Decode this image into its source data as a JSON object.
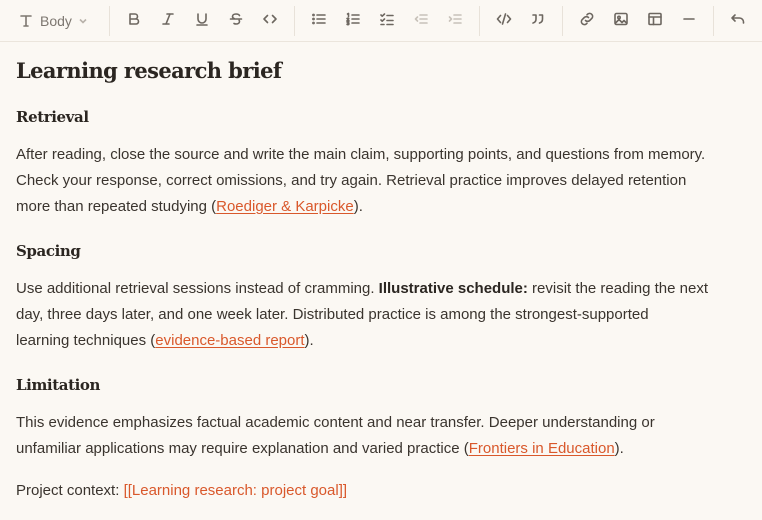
{
  "toolbar": {
    "text_style": "Body",
    "icons": [
      "text-type-icon",
      "bold-icon",
      "italic-icon",
      "underline-icon",
      "strikethrough-icon",
      "inline-code-icon",
      "bullet-list-icon",
      "numbered-list-icon",
      "task-list-icon",
      "outdent-icon",
      "indent-icon",
      "code-block-icon",
      "blockquote-icon",
      "link-icon",
      "image-icon",
      "table-icon",
      "horizontal-rule-icon",
      "undo-icon"
    ]
  },
  "doc": {
    "title": "Learning research brief",
    "sections": [
      {
        "heading": "Retrieval",
        "line1": "After reading, close the source and write the main claim, supporting points, and questions from memory.",
        "line2": "Check your response, correct omissions, and try again. Retrieval practice improves delayed retention",
        "line3_pre": "more than repeated studying (",
        "link": "Roediger & Karpicke",
        "line3_post": ")."
      },
      {
        "heading": "Spacing",
        "line1_pre": "Use additional retrieval sessions instead of cramming. ",
        "bold": "Illustrative schedule:",
        "line1_post": " revisit the reading the next",
        "line2": "day, three days later, and one week later. Distributed practice is among the strongest-supported",
        "line3_pre": "learning techniques (",
        "link": "evidence-based report",
        "line3_post": ")."
      },
      {
        "heading": "Limitation",
        "line1": "This evidence emphasizes factual academic content and near transfer. Deeper understanding or",
        "line2_pre": "unfamiliar applications may require explanation and varied practice (",
        "link": "Frontiers in Education",
        "line2_post": ")."
      }
    ],
    "context_label": "Project context: ",
    "context_link": "[[Learning research: project goal]]"
  },
  "colors": {
    "accent": "#d9582b",
    "background": "#fbf8f3",
    "text": "#2b2621"
  }
}
